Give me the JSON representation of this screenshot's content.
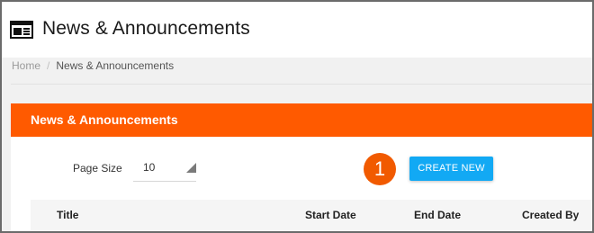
{
  "page": {
    "title": "News & Announcements",
    "icon": "newspaper-icon"
  },
  "breadcrumb": {
    "home": "Home",
    "separator": "/",
    "current": "News & Announcements"
  },
  "panel": {
    "title": "News & Announcements",
    "header_color": "#ff5a00"
  },
  "controls": {
    "page_size_label": "Page Size",
    "page_size_value": "10",
    "step_number": "1",
    "create_label": "CREATE NEW",
    "create_color": "#12a9f4"
  },
  "table": {
    "columns": [
      "Title",
      "Start Date",
      "End Date",
      "Created By"
    ]
  }
}
